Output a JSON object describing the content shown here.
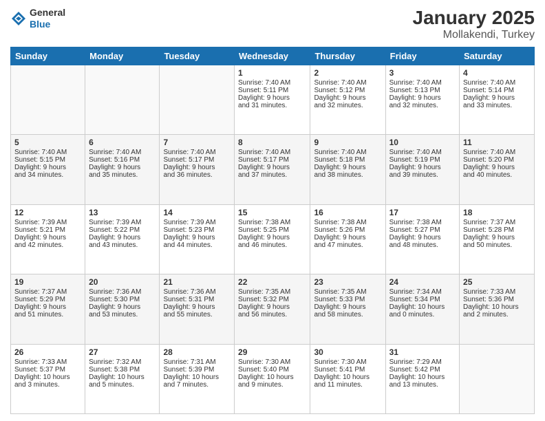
{
  "header": {
    "logo": {
      "general": "General",
      "blue": "Blue"
    },
    "title": "January 2025",
    "subtitle": "Mollakendi, Turkey"
  },
  "calendar": {
    "days_of_week": [
      "Sunday",
      "Monday",
      "Tuesday",
      "Wednesday",
      "Thursday",
      "Friday",
      "Saturday"
    ],
    "weeks": [
      {
        "shaded": false,
        "days": [
          {
            "num": "",
            "content": ""
          },
          {
            "num": "",
            "content": ""
          },
          {
            "num": "",
            "content": ""
          },
          {
            "num": "1",
            "content": "Sunrise: 7:40 AM\nSunset: 5:11 PM\nDaylight: 9 hours\nand 31 minutes."
          },
          {
            "num": "2",
            "content": "Sunrise: 7:40 AM\nSunset: 5:12 PM\nDaylight: 9 hours\nand 32 minutes."
          },
          {
            "num": "3",
            "content": "Sunrise: 7:40 AM\nSunset: 5:13 PM\nDaylight: 9 hours\nand 32 minutes."
          },
          {
            "num": "4",
            "content": "Sunrise: 7:40 AM\nSunset: 5:14 PM\nDaylight: 9 hours\nand 33 minutes."
          }
        ]
      },
      {
        "shaded": true,
        "days": [
          {
            "num": "5",
            "content": "Sunrise: 7:40 AM\nSunset: 5:15 PM\nDaylight: 9 hours\nand 34 minutes."
          },
          {
            "num": "6",
            "content": "Sunrise: 7:40 AM\nSunset: 5:16 PM\nDaylight: 9 hours\nand 35 minutes."
          },
          {
            "num": "7",
            "content": "Sunrise: 7:40 AM\nSunset: 5:17 PM\nDaylight: 9 hours\nand 36 minutes."
          },
          {
            "num": "8",
            "content": "Sunrise: 7:40 AM\nSunset: 5:17 PM\nDaylight: 9 hours\nand 37 minutes."
          },
          {
            "num": "9",
            "content": "Sunrise: 7:40 AM\nSunset: 5:18 PM\nDaylight: 9 hours\nand 38 minutes."
          },
          {
            "num": "10",
            "content": "Sunrise: 7:40 AM\nSunset: 5:19 PM\nDaylight: 9 hours\nand 39 minutes."
          },
          {
            "num": "11",
            "content": "Sunrise: 7:40 AM\nSunset: 5:20 PM\nDaylight: 9 hours\nand 40 minutes."
          }
        ]
      },
      {
        "shaded": false,
        "days": [
          {
            "num": "12",
            "content": "Sunrise: 7:39 AM\nSunset: 5:21 PM\nDaylight: 9 hours\nand 42 minutes."
          },
          {
            "num": "13",
            "content": "Sunrise: 7:39 AM\nSunset: 5:22 PM\nDaylight: 9 hours\nand 43 minutes."
          },
          {
            "num": "14",
            "content": "Sunrise: 7:39 AM\nSunset: 5:23 PM\nDaylight: 9 hours\nand 44 minutes."
          },
          {
            "num": "15",
            "content": "Sunrise: 7:38 AM\nSunset: 5:25 PM\nDaylight: 9 hours\nand 46 minutes."
          },
          {
            "num": "16",
            "content": "Sunrise: 7:38 AM\nSunset: 5:26 PM\nDaylight: 9 hours\nand 47 minutes."
          },
          {
            "num": "17",
            "content": "Sunrise: 7:38 AM\nSunset: 5:27 PM\nDaylight: 9 hours\nand 48 minutes."
          },
          {
            "num": "18",
            "content": "Sunrise: 7:37 AM\nSunset: 5:28 PM\nDaylight: 9 hours\nand 50 minutes."
          }
        ]
      },
      {
        "shaded": true,
        "days": [
          {
            "num": "19",
            "content": "Sunrise: 7:37 AM\nSunset: 5:29 PM\nDaylight: 9 hours\nand 51 minutes."
          },
          {
            "num": "20",
            "content": "Sunrise: 7:36 AM\nSunset: 5:30 PM\nDaylight: 9 hours\nand 53 minutes."
          },
          {
            "num": "21",
            "content": "Sunrise: 7:36 AM\nSunset: 5:31 PM\nDaylight: 9 hours\nand 55 minutes."
          },
          {
            "num": "22",
            "content": "Sunrise: 7:35 AM\nSunset: 5:32 PM\nDaylight: 9 hours\nand 56 minutes."
          },
          {
            "num": "23",
            "content": "Sunrise: 7:35 AM\nSunset: 5:33 PM\nDaylight: 9 hours\nand 58 minutes."
          },
          {
            "num": "24",
            "content": "Sunrise: 7:34 AM\nSunset: 5:34 PM\nDaylight: 10 hours\nand 0 minutes."
          },
          {
            "num": "25",
            "content": "Sunrise: 7:33 AM\nSunset: 5:36 PM\nDaylight: 10 hours\nand 2 minutes."
          }
        ]
      },
      {
        "shaded": false,
        "days": [
          {
            "num": "26",
            "content": "Sunrise: 7:33 AM\nSunset: 5:37 PM\nDaylight: 10 hours\nand 3 minutes."
          },
          {
            "num": "27",
            "content": "Sunrise: 7:32 AM\nSunset: 5:38 PM\nDaylight: 10 hours\nand 5 minutes."
          },
          {
            "num": "28",
            "content": "Sunrise: 7:31 AM\nSunset: 5:39 PM\nDaylight: 10 hours\nand 7 minutes."
          },
          {
            "num": "29",
            "content": "Sunrise: 7:30 AM\nSunset: 5:40 PM\nDaylight: 10 hours\nand 9 minutes."
          },
          {
            "num": "30",
            "content": "Sunrise: 7:30 AM\nSunset: 5:41 PM\nDaylight: 10 hours\nand 11 minutes."
          },
          {
            "num": "31",
            "content": "Sunrise: 7:29 AM\nSunset: 5:42 PM\nDaylight: 10 hours\nand 13 minutes."
          },
          {
            "num": "",
            "content": ""
          }
        ]
      }
    ]
  }
}
